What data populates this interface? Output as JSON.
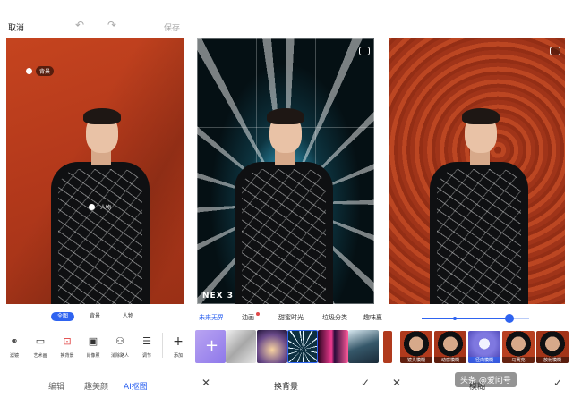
{
  "top_bar": {
    "cancel": "取消",
    "save": "保存"
  },
  "left_panel": {
    "tag_background": "背景",
    "tag_person": "人物",
    "segments": [
      "全图",
      "背景",
      "人物"
    ],
    "tools": [
      {
        "label": "滤镜",
        "icon": "filter-icon"
      },
      {
        "label": "艺术画",
        "icon": "art-icon"
      },
      {
        "label": "换背景",
        "icon": "replace-bg-icon"
      },
      {
        "label": "肖像照",
        "icon": "portrait-icon"
      },
      {
        "label": "消除路人",
        "icon": "remove-people-icon"
      },
      {
        "label": "调节",
        "icon": "adjust-icon"
      },
      {
        "label": "添加",
        "icon": "add-icon"
      }
    ],
    "bottom_tabs": [
      "编辑",
      "趣美颜",
      "AI抠图"
    ]
  },
  "middle_panel": {
    "watermark": "NEX 3",
    "categories": [
      "未来无界",
      "油画",
      "甜蜜时光",
      "垃圾分类",
      "趣味夏"
    ],
    "bottom_title": "换背景"
  },
  "right_panel": {
    "slider_value": 0.82,
    "blur_options": [
      "镜头模糊",
      "动感模糊",
      "径向模糊",
      "马赛克",
      "放射模糊"
    ],
    "bottom_title": "模糊",
    "watermark": "头条 @爱问号"
  },
  "colors": {
    "accent": "#2e63f0",
    "wall": "#b4391b"
  }
}
